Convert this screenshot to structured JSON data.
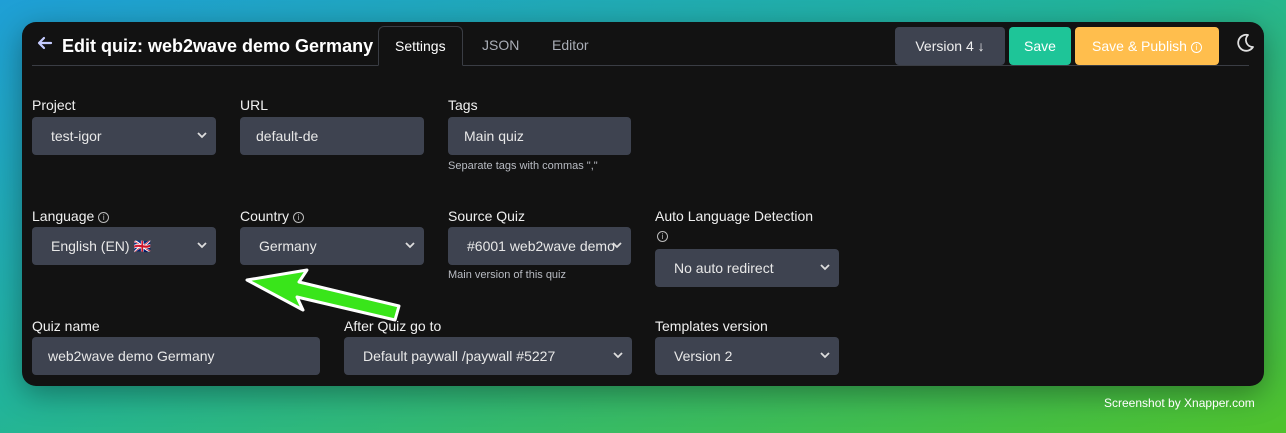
{
  "header": {
    "title": "Edit quiz: web2wave demo Germany",
    "tabs": [
      {
        "label": "Settings",
        "active": true
      },
      {
        "label": "JSON",
        "active": false
      },
      {
        "label": "Editor",
        "active": false
      }
    ],
    "version_label": "Version 4 ↓",
    "save_label": "Save",
    "publish_label": "Save & Publish",
    "colors": {
      "save": "#1ec598",
      "publish": "#ffbe4d",
      "version": "#3e4350"
    }
  },
  "form": {
    "project": {
      "label": "Project",
      "value": "test-igor"
    },
    "url": {
      "label": "URL",
      "value": "default-de"
    },
    "tags": {
      "label": "Tags",
      "value": "Main quiz",
      "hint": "Separate tags with commas \",\""
    },
    "language": {
      "label": "Language",
      "value": "English (EN) 🇬🇧"
    },
    "country": {
      "label": "Country",
      "value": "Germany"
    },
    "source_quiz": {
      "label": "Source Quiz",
      "value": "#6001 web2wave demo",
      "hint": "Main version of this quiz"
    },
    "auto_language": {
      "label": "Auto Language Detection",
      "value": "No auto redirect"
    },
    "quiz_name": {
      "label": "Quiz name",
      "value": "web2wave demo Germany"
    },
    "after_quiz": {
      "label": "After Quiz go to",
      "value": "Default paywall /paywall #5227"
    },
    "templates_version": {
      "label": "Templates version",
      "value": "Version 2"
    }
  },
  "icons": {
    "back": "arrow-left-icon",
    "theme": "moon-icon",
    "annotation": "green-arrow-icon"
  },
  "watermark": "Screenshot by Xnapper.com"
}
